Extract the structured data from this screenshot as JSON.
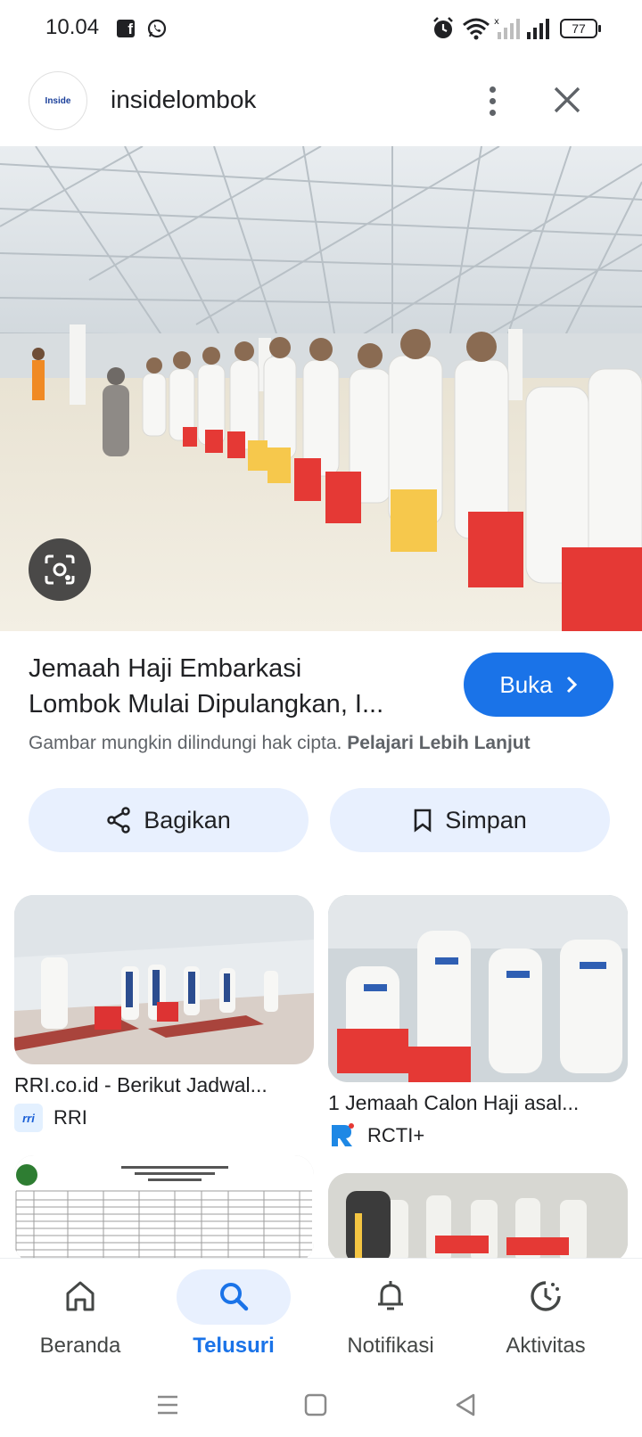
{
  "status_bar": {
    "time": "10.04",
    "battery": "77"
  },
  "header": {
    "source_name": "insidelombok",
    "logo_text": "Inside"
  },
  "result": {
    "title_line1": "Jemaah Haji Embarkasi",
    "title_line2": "Lombok Mulai Dipulangkan, I...",
    "open_label": "Buka",
    "copyright_text": "Gambar mungkin dilindungi hak cipta.",
    "learn_more": "Pelajari Lebih Lanjut"
  },
  "actions": {
    "share_label": "Bagikan",
    "save_label": "Simpan"
  },
  "related": [
    {
      "title": "RRI.co.id - Berikut Jadwal...",
      "source": "RRI",
      "favicon": "rri"
    },
    {
      "title": "1 Jemaah Calon Haji asal...",
      "source": "RCTI+",
      "favicon": "rcti"
    }
  ],
  "bottom_nav": [
    {
      "label": "Beranda",
      "icon": "home-icon",
      "active": false
    },
    {
      "label": "Telusuri",
      "icon": "search-icon",
      "active": true
    },
    {
      "label": "Notifikasi",
      "icon": "bell-icon",
      "active": false
    },
    {
      "label": "Aktivitas",
      "icon": "activity-icon",
      "active": false
    }
  ],
  "colors": {
    "accent": "#1a73e8",
    "chip_bg": "#e8f0fe",
    "text_secondary": "#5f6368"
  }
}
